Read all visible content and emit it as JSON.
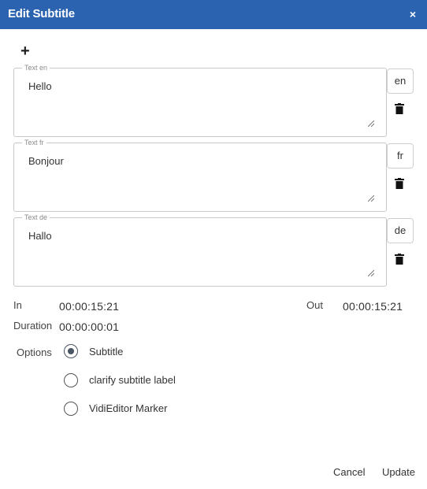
{
  "dialog": {
    "title": "Edit Subtitle",
    "close_label": "×",
    "add_label": "+"
  },
  "texts": [
    {
      "legend": "Text en",
      "value": "Hello",
      "lang": "en"
    },
    {
      "legend": "Text fr",
      "value": "Bonjour",
      "lang": "fr"
    },
    {
      "legend": "Text de",
      "value": "Hallo",
      "lang": "de"
    }
  ],
  "timing": {
    "in_label": "In",
    "in_value": "00:00:15:21",
    "out_label": "Out",
    "out_value": "00:00:15:21",
    "duration_label": "Duration",
    "duration_value": "00:00:00:01"
  },
  "options": {
    "label": "Options",
    "items": [
      {
        "label": "Subtitle",
        "checked": true
      },
      {
        "label": "clarify subtitle label",
        "checked": false
      },
      {
        "label": "VidiEditor Marker",
        "checked": false
      }
    ]
  },
  "footer": {
    "cancel_label": "Cancel",
    "update_label": "Update"
  },
  "colors": {
    "titlebar": "#2c63b0",
    "radio_checked": "#4a5563"
  },
  "icons": {
    "close": "close-icon",
    "add": "plus-icon",
    "delete": "trash-icon",
    "resize": "resize-handle-icon"
  }
}
